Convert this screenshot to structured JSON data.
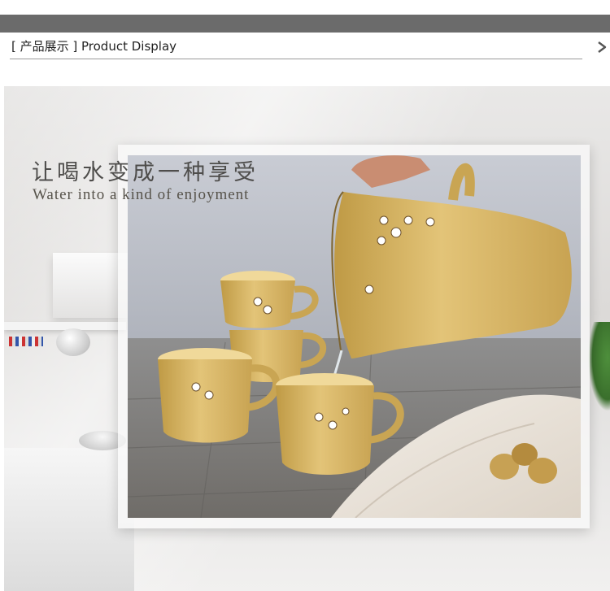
{
  "header": {
    "title": "[ 产品展示 ] Product Display",
    "more_icon": "chevron-right-icon"
  },
  "banner": {
    "headline_cn": "让喝水变成一种享受",
    "headline_en": "Water into a kind of enjoyment"
  },
  "colors": {
    "top_bar": "#6b6b6b",
    "mug_glaze": "#d8b45e",
    "headline_text": "#4e4d4b"
  }
}
